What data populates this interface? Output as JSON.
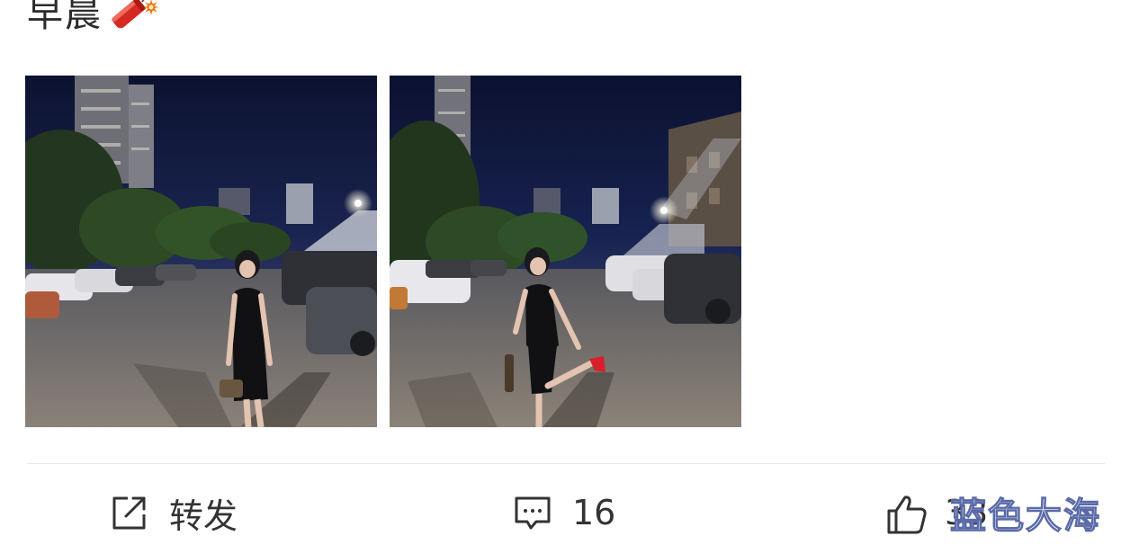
{
  "post": {
    "text": "早晨",
    "emoji": "firecracker-icon"
  },
  "photos": [
    {
      "name": "photo-night-street-1",
      "alt": ""
    },
    {
      "name": "photo-night-street-2",
      "alt": ""
    }
  ],
  "actions": {
    "repost_label": "转发",
    "comment_count": "16",
    "like_count": "33"
  },
  "watermark": {
    "text": "蓝色大海"
  },
  "colors": {
    "text": "#333333",
    "divider": "#e8e8e8",
    "sky": "#0f1630"
  }
}
